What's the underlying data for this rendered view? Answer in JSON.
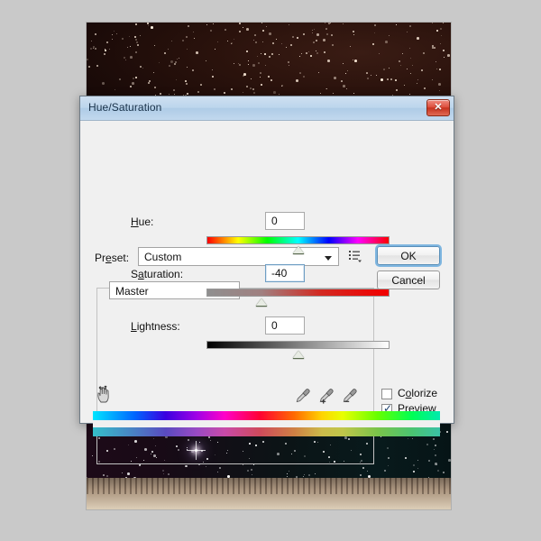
{
  "app": {
    "background_photo": {
      "description": "night-sky-desert-photo",
      "top_band": "starry night sky, dark brown",
      "bottom_band": "desert badlands under starry sky"
    }
  },
  "dialog": {
    "title": "Hue/Saturation",
    "close_icon": "close-icon",
    "close_glyph": "✕",
    "preset": {
      "label": "Preset:",
      "label_accel_prefix": "Pr",
      "label_accel_char": "e",
      "label_accel_suffix": "set:",
      "value": "Custom",
      "menu_icon": "preset-options-icon"
    },
    "buttons": {
      "ok": "OK",
      "cancel": "Cancel"
    },
    "channel": {
      "value": "Master"
    },
    "sliders": [
      {
        "id": "hue",
        "label_prefix": "",
        "label_accel": "H",
        "label_suffix": "ue:",
        "label": "Hue:",
        "value": "0",
        "thumb_percent": 50,
        "focused": false,
        "track": "hue-spectrum"
      },
      {
        "id": "saturation",
        "label_prefix": "S",
        "label_accel": "a",
        "label_suffix": "turation:",
        "label": "Saturation:",
        "value": "-40",
        "thumb_percent": 30,
        "focused": true,
        "track": "gray-to-red"
      },
      {
        "id": "lightness",
        "label_prefix": "",
        "label_accel": "L",
        "label_suffix": "ightness:",
        "label": "Lightness:",
        "value": "0",
        "thumb_percent": 50,
        "focused": false,
        "track": "black-to-white"
      }
    ],
    "tools": {
      "on_image_adjust_icon": "on-image-adjustment-hand-icon",
      "eyedropper_icon": "eyedropper-icon",
      "eyedropper_add_icon": "eyedropper-plus-icon",
      "eyedropper_subtract_icon": "eyedropper-minus-icon"
    },
    "checkboxes": [
      {
        "id": "colorize",
        "label": "Colorize",
        "label_prefix": "C",
        "label_accel": "o",
        "label_suffix": "lorize",
        "checked": false
      },
      {
        "id": "preview",
        "label": "Preview",
        "label_prefix": "",
        "label_accel": "P",
        "label_suffix": "review",
        "checked": true,
        "check_glyph": "✔"
      }
    ],
    "color_strips": {
      "before_label": "original-hue-spectrum",
      "after_label": "adjusted-hue-spectrum"
    }
  },
  "colors": {
    "dialog_background": "#f0f0f0",
    "titlebar_start": "#cfe0f1",
    "titlebar_end": "#aecbe6",
    "close_button": "#de5140",
    "focus_ring": "#7fb6e0",
    "page_background": "#c9c9c9"
  }
}
